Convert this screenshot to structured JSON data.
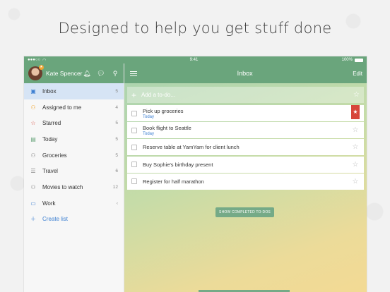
{
  "headline": "Designed to help you get stuff done",
  "statusbar": {
    "time": "9:41",
    "battery": "100%"
  },
  "sidebar": {
    "username": "Kate Spencer",
    "items": [
      {
        "label": "Inbox",
        "count": "5",
        "icon": "inbox-icon",
        "glyph": "▣",
        "active": true,
        "color": "#3c7fd1"
      },
      {
        "label": "Assigned to me",
        "count": "4",
        "icon": "person-icon",
        "glyph": "⚇",
        "color": "#f0a530"
      },
      {
        "label": "Starred",
        "count": "5",
        "icon": "star-icon",
        "glyph": "☆",
        "color": "#d7453a"
      },
      {
        "label": "Today",
        "count": "5",
        "icon": "calendar-icon",
        "glyph": "▤",
        "color": "#6aa57c"
      },
      {
        "label": "Groceries",
        "count": "5",
        "icon": "shared-list-icon",
        "glyph": "⚇",
        "color": "#888"
      },
      {
        "label": "Travel",
        "count": "6",
        "icon": "list-icon",
        "glyph": "☰",
        "color": "#888"
      },
      {
        "label": "Movies to watch",
        "count": "12",
        "icon": "shared-list-icon",
        "glyph": "⚇",
        "color": "#888"
      },
      {
        "label": "Work",
        "count": "‹",
        "icon": "folder-icon",
        "glyph": "▭",
        "color": "#3c7fd1"
      }
    ],
    "create_list": "Create list"
  },
  "main": {
    "title": "Inbox",
    "edit": "Edit",
    "add_placeholder": "Add a to-do...",
    "todos": [
      {
        "title": "Pick up groceries",
        "due": "Today",
        "starred": true
      },
      {
        "title": "Book flight to Seattle",
        "due": "Today",
        "starred": false
      },
      {
        "title": "Reserve table at YamYam for client lunch",
        "due": "",
        "starred": false
      },
      {
        "title": "Buy Sophie's birthday present",
        "due": "",
        "starred": false
      },
      {
        "title": "Register for half marathon",
        "due": "",
        "starred": false
      }
    ],
    "show_completed": "SHOW COMPLETED TO-DOS"
  },
  "colors": {
    "accent": "#6aa57c",
    "link": "#3c7fd1",
    "star": "#d7453a"
  }
}
